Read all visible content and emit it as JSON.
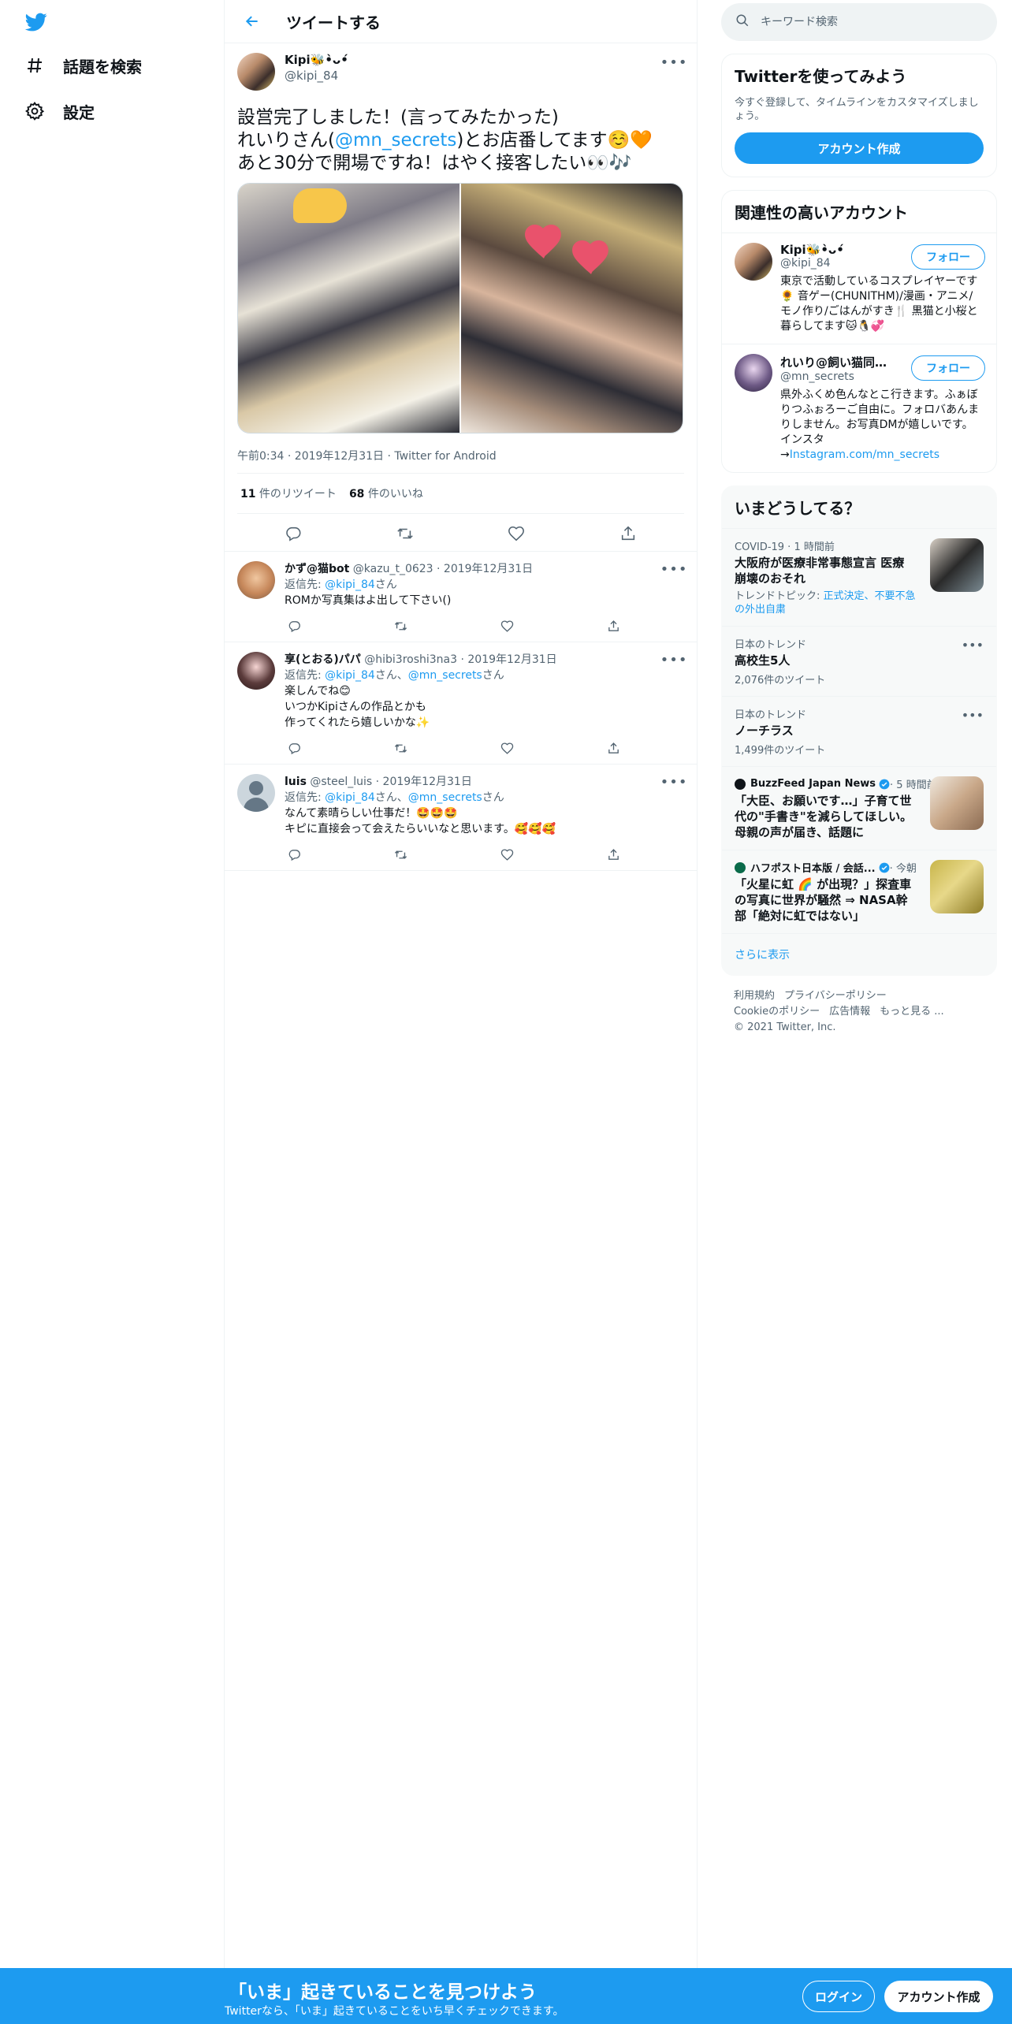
{
  "nav": {
    "logo_icon": "twitter-bird-icon",
    "items": [
      {
        "label": "話題を検索",
        "icon": "hashtag-icon"
      },
      {
        "label": "設定",
        "icon": "gear-icon"
      }
    ]
  },
  "header": {
    "title": "ツイートする"
  },
  "tweet": {
    "name": "Kipi🐝•̀ᴗ•́",
    "handle": "@kipi_84",
    "text_line1": "設営完了しました！(言ってみたかった)",
    "text_line2_pre": "れいりさん(",
    "text_line2_mention": "@mn_secrets",
    "text_line2_post": ")とお店番してます☺️🧡",
    "text_line3": "あと30分で開場ですね！はやく接客したい👀🎶",
    "meta": "午前0:34 · 2019年12月31日 · Twitter for Android",
    "retweets_count": "11",
    "retweets_label": " 件のリツイート",
    "likes_count": "68",
    "likes_label": " 件のいいね"
  },
  "replies": [
    {
      "name": "かず@猫bot",
      "handle_date": "@kazu_t_0623 · 2019年12月31日",
      "to_prefix": "返信先: ",
      "to_mention1": "@kipi_84",
      "to_suffix1": "さん",
      "to_sep": "",
      "to_mention2": "",
      "to_suffix2": "",
      "text": "ROMか写真集はよ出して下さい()"
    },
    {
      "name": "享(とおる)パパ",
      "handle_date": "@hibi3roshi3na3 · 2019年12月31日",
      "to_prefix": "返信先: ",
      "to_mention1": "@kipi_84",
      "to_suffix1": "さん、",
      "to_sep": "",
      "to_mention2": "@mn_secrets",
      "to_suffix2": "さん",
      "text": "楽しんでね😊\nいつかKipiさんの作品とかも\n作ってくれたら嬉しいかな✨"
    },
    {
      "name": "luis",
      "handle_date": "@steel_luis · 2019年12月31日",
      "to_prefix": "返信先: ",
      "to_mention1": "@kipi_84",
      "to_suffix1": "さん、",
      "to_sep": "",
      "to_mention2": "@mn_secrets",
      "to_suffix2": "さん",
      "text": "なんて素晴らしい仕事だ！🤩🤩🤩\nキピに直接会って会えたらいいなと思います。🥰🥰🥰"
    }
  ],
  "search": {
    "placeholder": "キーワード検索"
  },
  "signup_panel": {
    "title": "Twitterを使ってみよう",
    "subtitle": "今すぐ登録して、タイムラインをカスタマイズしましょう。",
    "button": "アカウント作成"
  },
  "accounts_panel": {
    "title": "関連性の高いアカウント",
    "follow_label": "フォロー",
    "accounts": [
      {
        "name": "Kipi🐝•̀ᴗ•́",
        "handle": "@kipi_84",
        "bio": "東京で活動しているコスプレイヤーです🌻 音ゲー(CHUNITHM)/漫画・アニメ/モノ作り/ごはんがすき🍴 黒猫と小桜と暮らしてます🐱🐧💞",
        "bio_link": ""
      },
      {
        "name": "れいり@飼い猫同士...",
        "handle": "@mn_secrets",
        "bio": "県外ふくめ色んなとこ行きます。ふぁぼりつふぉろーご自由に。フォロバあんまりしません。お写真DMが嬉しいです。インスタ\n→",
        "bio_link": "Instagram.com/mn_secrets"
      }
    ]
  },
  "trends_panel": {
    "title": "いまどうしてる？",
    "items": [
      {
        "context": "COVID-19 · 1 時間前",
        "title": "大阪府が医療非常事態宣言 医療崩壊のおそれ",
        "topic_prefix": "トレンドトピック: ",
        "topic_link": "正式決定、不要不急の外出自粛"
      },
      {
        "context": "日本のトレンド",
        "title": "高校生5人",
        "count": "2,076件のツイート"
      },
      {
        "context": "日本のトレンド",
        "title": "ノーチラス",
        "count": "1,499件のツイート"
      },
      {
        "source": "BuzzFeed Japan News",
        "time": " · 5 時間前",
        "title": "「大臣、お願いです…」子育て世代の\"手書き\"を減らしてほしい。母親の声が届き、話題に"
      },
      {
        "source": "ハフポスト日本版 / 会話...",
        "time": " · 今朝",
        "title": "「火星に虹 🌈 が出現？」探査車の写真に世界が騒然 ⇒ NASA幹部「絶対に虹ではない」"
      }
    ],
    "show_more": "さらに表示"
  },
  "footer": {
    "links_row1": [
      "利用規約",
      "プライバシーポリシー"
    ],
    "links_row2": [
      "Cookieのポリシー",
      "広告情報",
      "もっと見る ..."
    ],
    "copyright": "© 2021 Twitter, Inc."
  },
  "bottom_bar": {
    "title": "「いま」起きていることを見つけよう",
    "subtitle": "Twitterなら、「いま」起きていることをいち早くチェックできます。",
    "login": "ログイン",
    "signup": "アカウント作成"
  },
  "colors": {
    "accent": "#1d9bf0",
    "text": "#0f1419",
    "secondary": "#536471",
    "border": "#eff3f4"
  }
}
